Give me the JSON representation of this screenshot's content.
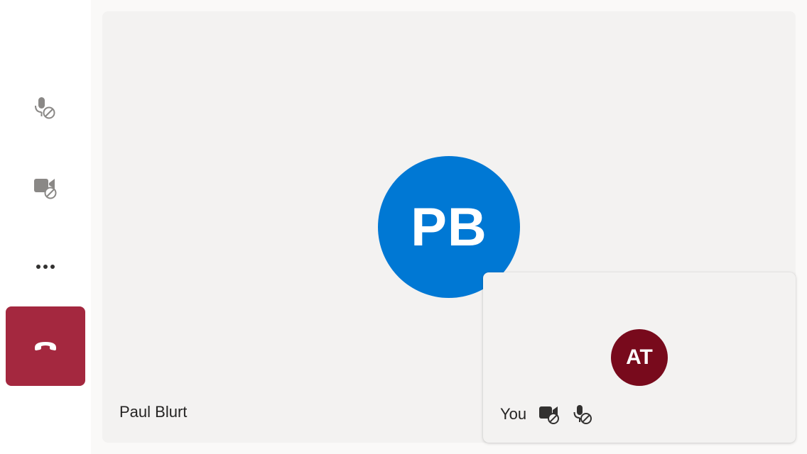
{
  "controls": {
    "mic_icon": "mic-off-icon",
    "camera_icon": "camera-off-icon",
    "more_icon": "more-options-icon",
    "hangup_icon": "hang-up-icon",
    "hangup_color": "#a4283f"
  },
  "main_participant": {
    "initials": "PB",
    "name": "Paul Blurt",
    "avatar_color": "#0078d4"
  },
  "self_view": {
    "initials": "AT",
    "name": "You",
    "avatar_color": "#780a1c",
    "status_icons": [
      "camera-off-icon",
      "mic-off-icon"
    ]
  }
}
